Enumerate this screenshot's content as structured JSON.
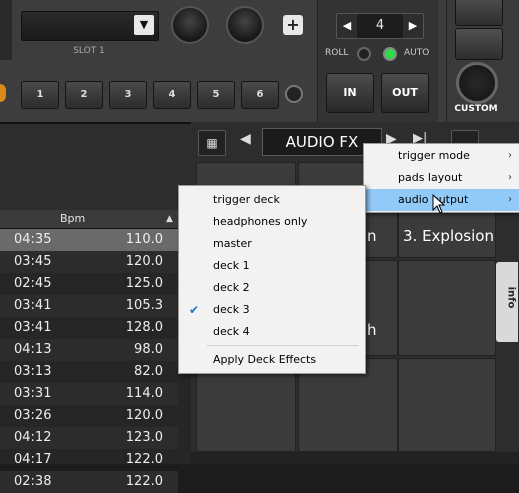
{
  "deck": {
    "slot_label": "SLOT 1",
    "loop_value": "4",
    "roll_label": "ROLL",
    "auto_label": "AUTO",
    "in_label": "IN",
    "out_label": "OUT",
    "custom_label": "CUSTOM",
    "hotcues": [
      "1",
      "2",
      "3",
      "4",
      "5",
      "6"
    ]
  },
  "browser": {
    "column_bpm": "Bpm",
    "rows": [
      {
        "time": "04:35",
        "bpm": "110.0"
      },
      {
        "time": "03:45",
        "bpm": "120.0"
      },
      {
        "time": "02:45",
        "bpm": "125.0"
      },
      {
        "time": "03:41",
        "bpm": "105.3"
      },
      {
        "time": "03:41",
        "bpm": "128.0"
      },
      {
        "time": "04:13",
        "bpm": "98.0"
      },
      {
        "time": "03:13",
        "bpm": "82.0"
      },
      {
        "time": "03:31",
        "bpm": "114.0"
      },
      {
        "time": "03:26",
        "bpm": "120.0"
      },
      {
        "time": "04:12",
        "bpm": "123.0"
      },
      {
        "time": "04:17",
        "bpm": "122.0"
      },
      {
        "time": "02:38",
        "bpm": "122.0"
      }
    ]
  },
  "pads": {
    "mode_label": "AUDIO FX",
    "pad3": "3. Explosion",
    "pad2_partial": "n",
    "pad6_partial": "h",
    "info_tab": "info"
  },
  "menu_main": [
    {
      "label": "trigger mode"
    },
    {
      "label": "pads layout"
    },
    {
      "label": "audio output"
    }
  ],
  "menu_sub": [
    {
      "label": "trigger deck"
    },
    {
      "label": "headphones only"
    },
    {
      "label": "master"
    },
    {
      "label": "deck 1"
    },
    {
      "label": "deck 2"
    },
    {
      "label": "deck 3"
    },
    {
      "label": "deck 4"
    },
    {
      "label": "Apply Deck Effects"
    }
  ]
}
